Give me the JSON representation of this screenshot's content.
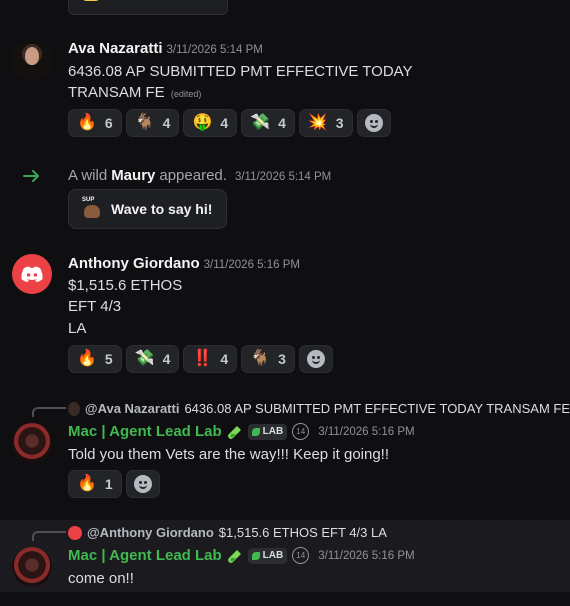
{
  "messages": [
    {
      "id": "ava",
      "username": "Ava Nazaratti",
      "timestamp": "3/11/2026 5:14 PM",
      "lines": [
        "6436.08 AP SUBMITTED PMT EFFECTIVE TODAY",
        "TRANSAM FE"
      ],
      "edited_label": "(edited)",
      "reactions": [
        {
          "emoji": "🔥",
          "count": "6"
        },
        {
          "emoji": "🐐",
          "count": "4"
        },
        {
          "emoji": "🤑",
          "count": "4"
        },
        {
          "emoji": "💸",
          "count": "4"
        },
        {
          "emoji": "💥",
          "count": "3"
        }
      ]
    },
    {
      "id": "maury",
      "prefix": "A wild",
      "username": "Maury",
      "suffix": "appeared.",
      "timestamp": "3/11/2026 5:14 PM",
      "wave_label": "Wave to say hi!",
      "wave_sticker": "SUP"
    },
    {
      "id": "anthony",
      "username": "Anthony Giordano",
      "timestamp": "3/11/2026 5:16 PM",
      "lines": [
        "$1,515.6 ETHOS",
        "EFT 4/3",
        "LA"
      ],
      "reactions": [
        {
          "emoji": "🔥",
          "count": "5"
        },
        {
          "emoji": "💸",
          "count": "4"
        },
        {
          "emoji": "‼️",
          "count": "4"
        },
        {
          "emoji": "🐐",
          "count": "3"
        }
      ]
    },
    {
      "id": "mac1",
      "reply_name": "@Ava Nazaratti",
      "reply_text": "6436.08 AP SUBMITTED PMT EFFECTIVE TODAY  TRANSAM FE",
      "username": "Mac | Agent Lead Lab",
      "tag": "LAB",
      "badge": "14",
      "timestamp": "3/11/2026 5:16 PM",
      "lines": [
        "Told you them Vets are the way!!! Keep it going!!"
      ],
      "reactions": [
        {
          "emoji": "🔥",
          "count": "1"
        }
      ]
    },
    {
      "id": "mac2",
      "reply_name": "@Anthony Giordano",
      "reply_text": "$1,515.6 ETHOS EFT 4/3 LA",
      "username": "Mac | Agent Lead Lab",
      "tag": "LAB",
      "badge": "14",
      "timestamp": "3/11/2026 5:16 PM",
      "lines": [
        "come on!!"
      ]
    }
  ],
  "colors": {
    "background": "#0f0f11",
    "role_green": "#3fb950",
    "discord_red": "#ed4245",
    "join_arrow": "#3ba55d"
  },
  "icons": {
    "join": "arrow-right-icon",
    "add_reaction": "smiley-icon",
    "tool": "test-tube-icon",
    "tag": "leaf-icon"
  }
}
